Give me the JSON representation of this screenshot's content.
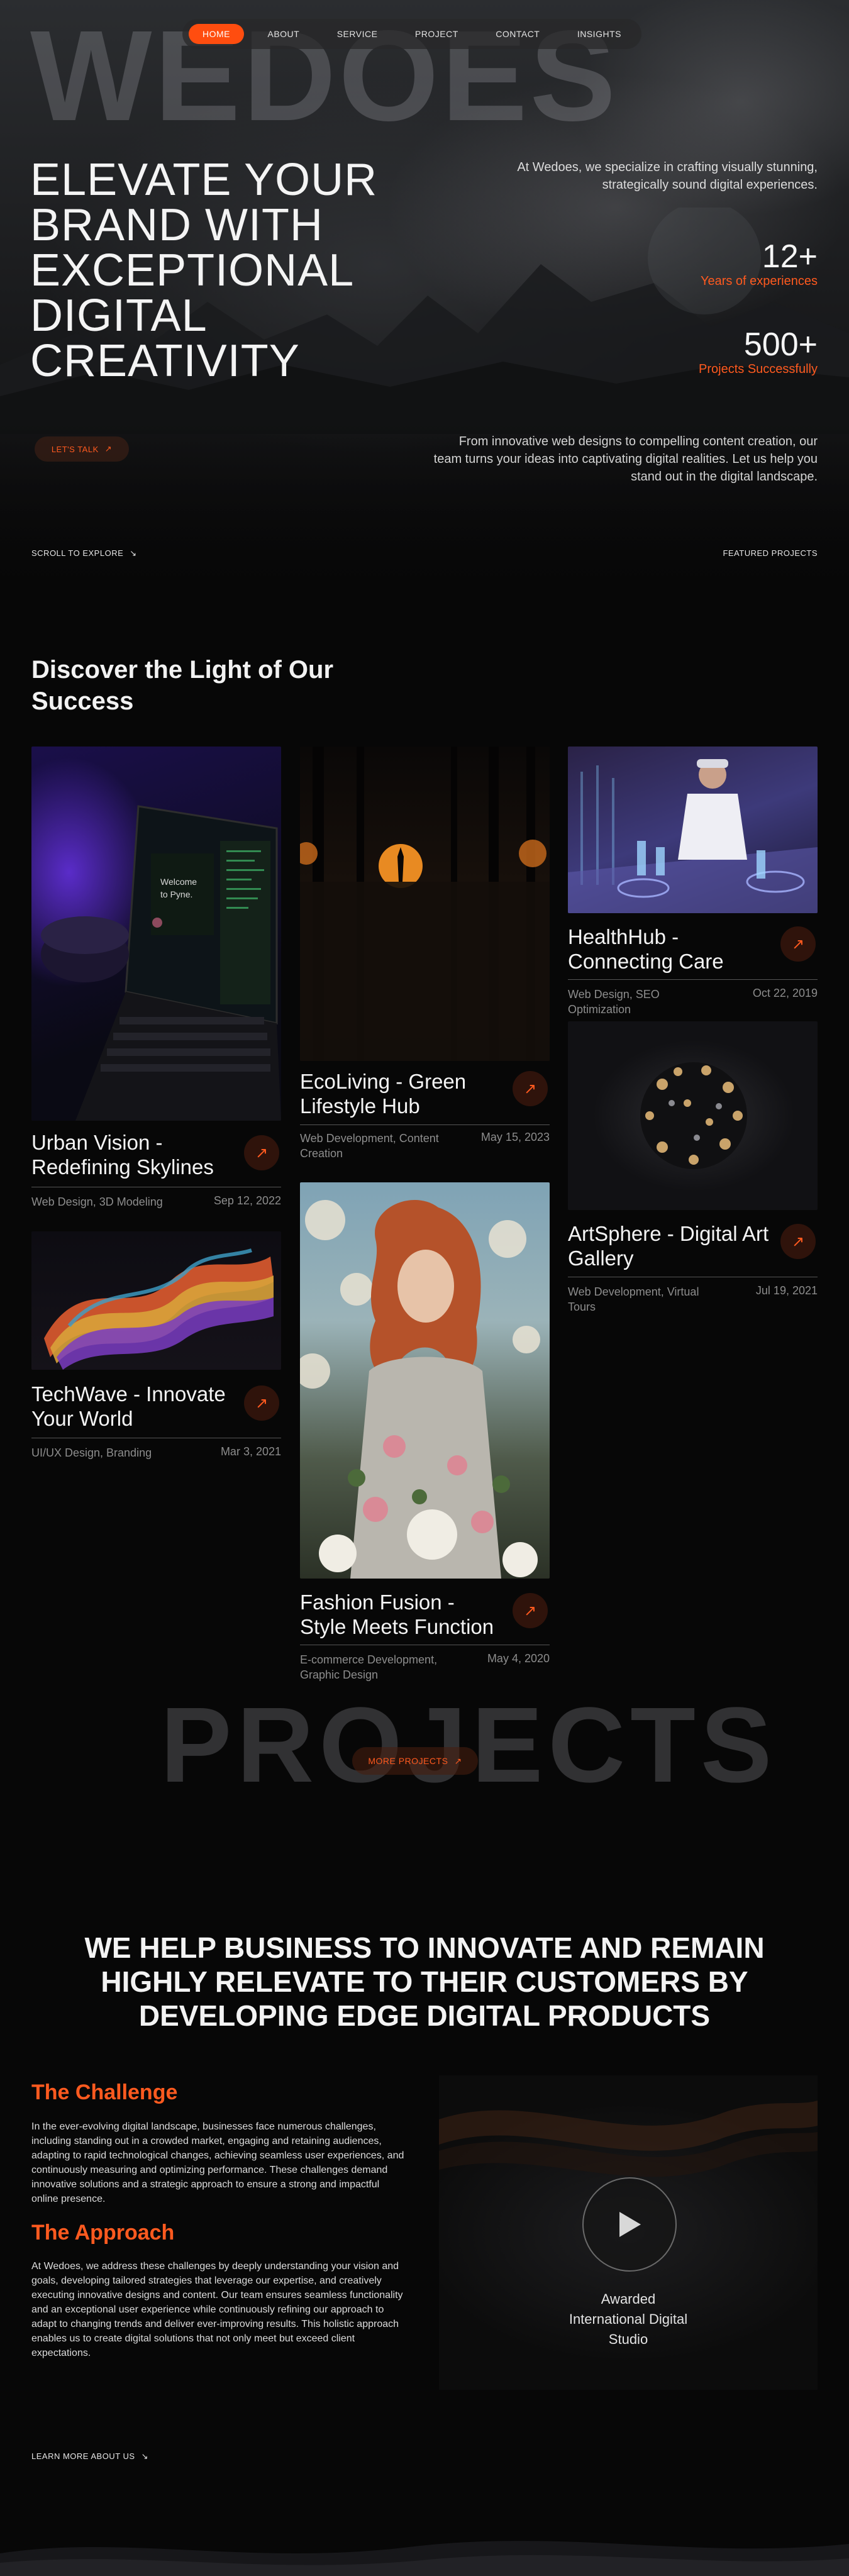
{
  "nav": {
    "items": [
      {
        "label": "HOME",
        "active": true
      },
      {
        "label": "ABOUT",
        "active": false
      },
      {
        "label": "SERVICE",
        "active": false
      },
      {
        "label": "PROJECT",
        "active": false
      },
      {
        "label": "CONTACT",
        "active": false
      },
      {
        "label": "INSIGHTS",
        "active": false
      }
    ]
  },
  "hero": {
    "brand_watermark": "WEDOES",
    "title": "ELEVATE YOUR BRAND WITH EXCEPTIONAL DIGITAL CREATIVITY",
    "intro": "At Wedoes, we specialize in crafting visually stunning, strategically sound digital experiences.",
    "stats": [
      {
        "value": "12+",
        "label": "Years of experiences"
      },
      {
        "value": "500+",
        "label": "Projects Successfully"
      }
    ],
    "description": "From innovative web designs to compelling content creation, our team turns your ideas into captivating digital realities. Let us help you stand out in the digital landscape.",
    "cta_label": "LET'S TALK",
    "cta_icon": "arrow-up-right-icon",
    "scroll_label": "SCROLL TO EXPLORE",
    "scroll_icon": "arrow-down-right-icon",
    "featured_label": "FEATURED PROJECTS"
  },
  "projects": {
    "heading": "Discover the Light of Our Success",
    "cards": [
      {
        "title": "Urban Vision - Redefining Skylines",
        "tags": "Web Design, 3D Modeling",
        "date": "Sep 12, 2022",
        "image": "laptop-code"
      },
      {
        "title": "TechWave - Innovate Your World",
        "tags": "UI/UX Design, Branding",
        "date": "Mar 3, 2021",
        "image": "colorful-wave"
      },
      {
        "title": "EcoLiving - Green Lifestyle Hub",
        "tags": "Web Development, Content Creation",
        "date": "May 15, 2023",
        "image": "forest-sunset"
      },
      {
        "title": "Fashion Fusion - Style Meets Function",
        "tags": "E-commerce Development, Graphic Design",
        "date": "May 4, 2020",
        "image": "portrait-flowers"
      },
      {
        "title": "HealthHub - Connecting Care",
        "tags": "Web Design, SEO Optimization",
        "date": "Oct 22, 2019",
        "image": "lab-scientist"
      },
      {
        "title": "ArtSphere - Digital Art Gallery",
        "tags": "Web Development, Virtual Tours",
        "date": "Jul 19, 2021",
        "image": "dark-sphere"
      }
    ],
    "watermark": "PROJECTS",
    "more_label": "MORE PROJECTS",
    "more_icon": "arrow-up-right-icon"
  },
  "about": {
    "mission": "WE HELP BUSINESS TO INNOVATE AND REMAIN HIGHLY RELEVATE TO THEIR CUSTOMERS BY DEVELOPING EDGE DIGITAL PRODUCTS",
    "challenge_title": "The Challenge",
    "challenge_text": "In the ever-evolving digital landscape, businesses face numerous challenges, including standing out in a crowded market, engaging and retaining audiences, adapting to rapid technological changes, achieving seamless user experiences, and continuously measuring and optimizing performance. These challenges demand innovative solutions and a strategic approach to ensure a strong and impactful online presence.",
    "approach_title": "The Approach",
    "approach_text": "At Wedoes, we address these challenges by deeply understanding your vision and goals, developing tailored strategies that leverage our expertise, and creatively executing innovative designs and content. Our team ensures seamless functionality and an exceptional user experience while continuously refining our approach to adapt to changing trends and deliver ever-improving results. This holistic approach enables us to create digital solutions that not only meet but exceed client expectations.",
    "video_caption": "Awarded International Digital Studio",
    "play_icon": "play-icon",
    "learn_more_label": "LEARN MORE ABOUT US",
    "learn_more_icon": "arrow-down-right-icon"
  },
  "colors": {
    "accent": "#ff5a1f",
    "background": "#070707"
  }
}
